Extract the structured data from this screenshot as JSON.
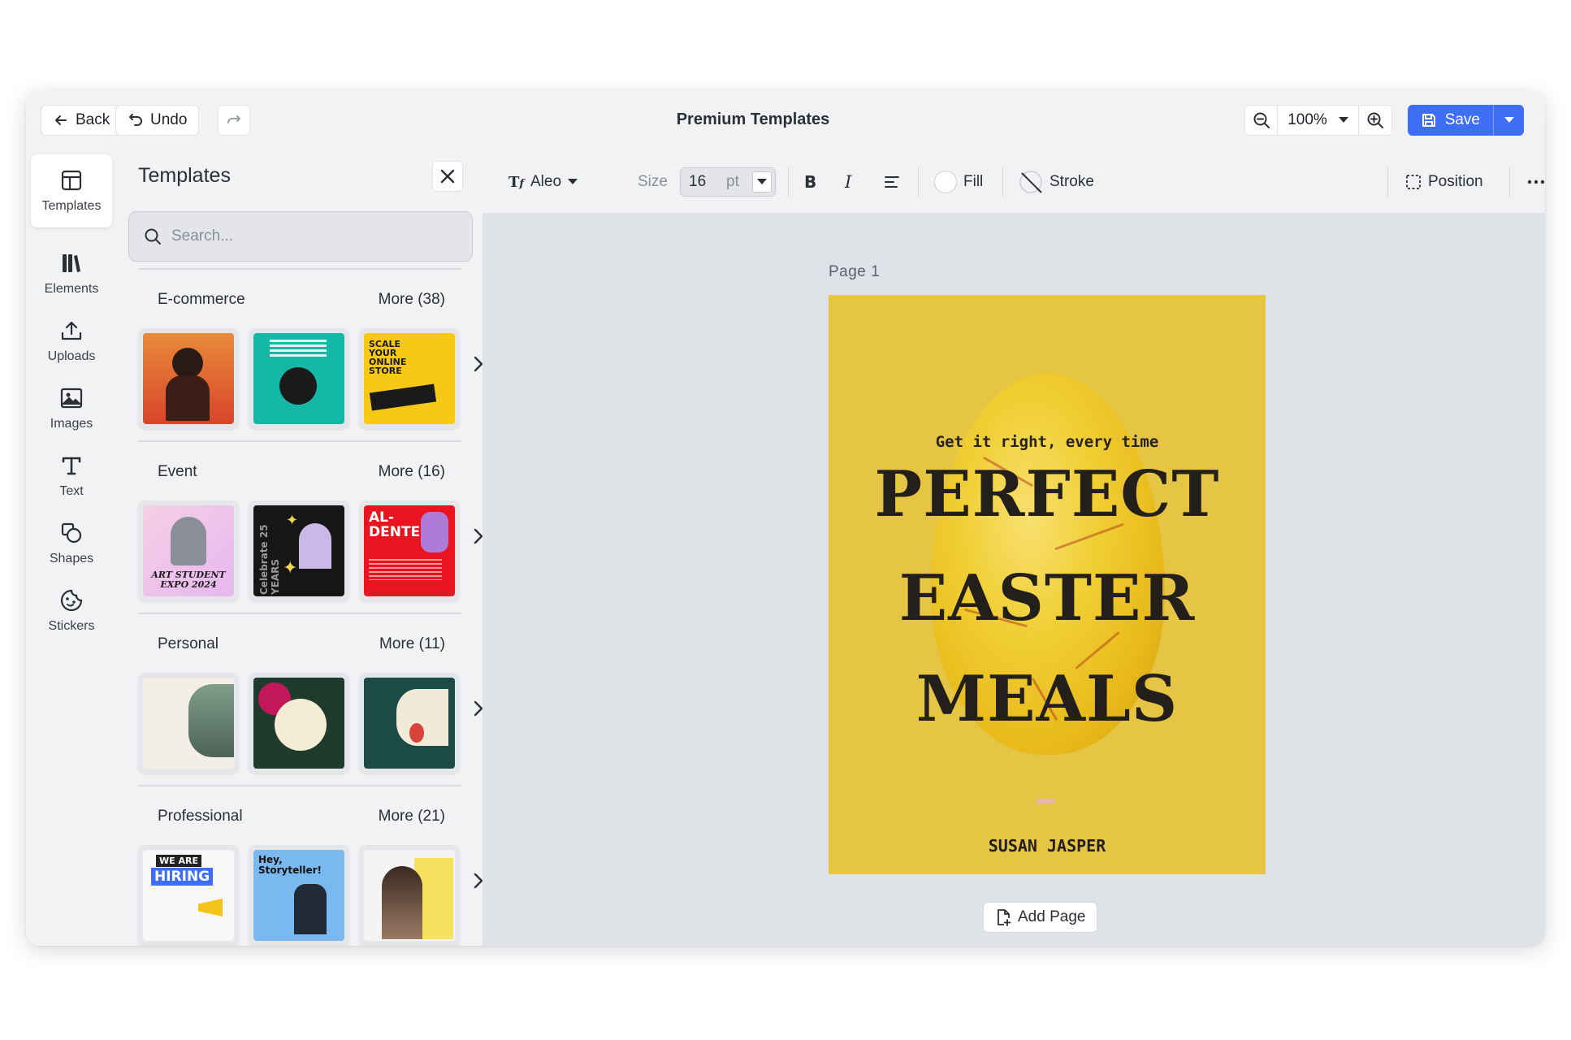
{
  "topbar": {
    "back_label": "Back",
    "undo_label": "Undo",
    "title": "Premium Templates",
    "zoom_value": "100%",
    "save_label": "Save"
  },
  "rail": [
    {
      "label": "Templates",
      "icon": "layout-icon",
      "active": true
    },
    {
      "label": "Elements",
      "icon": "library-icon"
    },
    {
      "label": "Uploads",
      "icon": "upload-icon"
    },
    {
      "label": "Images",
      "icon": "image-icon"
    },
    {
      "label": "Text",
      "icon": "text-icon"
    },
    {
      "label": "Shapes",
      "icon": "shapes-icon"
    },
    {
      "label": "Stickers",
      "icon": "sticker-icon"
    }
  ],
  "panel": {
    "title": "Templates",
    "search_placeholder": "Search...",
    "categories": [
      {
        "name": "E-commerce",
        "more": "More (38)"
      },
      {
        "name": "Event",
        "more": "More (16)"
      },
      {
        "name": "Personal",
        "more": "More (11)"
      },
      {
        "name": "Professional",
        "more": "More (21)"
      }
    ],
    "thumb_text": {
      "ecom3": "SCALE YOUR ONLINE STORE",
      "event1": "ART STUDENT EXPO 2024",
      "event2": "Celebrate 25 YEARS",
      "event3": "AL-DENTE",
      "prof1a": "WE ARE",
      "prof1b": "HIRING",
      "prof2": "Hey, Storyteller!"
    }
  },
  "toolbar": {
    "font": "Aleo",
    "size_label": "Size",
    "size_value": "16",
    "size_unit": "pt",
    "fill_label": "Fill",
    "stroke_label": "Stroke",
    "position_label": "Position"
  },
  "canvas": {
    "page_label": "Page  1",
    "subtitle": "Get it right, every time",
    "line1": "PERFECT",
    "line2": "EASTER",
    "line3": "MEALS",
    "author": "SUSAN JASPER",
    "add_page_label": "Add Page",
    "bg_color": "#e6c444"
  },
  "colors": {
    "accent": "#3d6ef5",
    "window_bg": "#f1f2f4",
    "canvas_bg": "#dfe2e6"
  }
}
